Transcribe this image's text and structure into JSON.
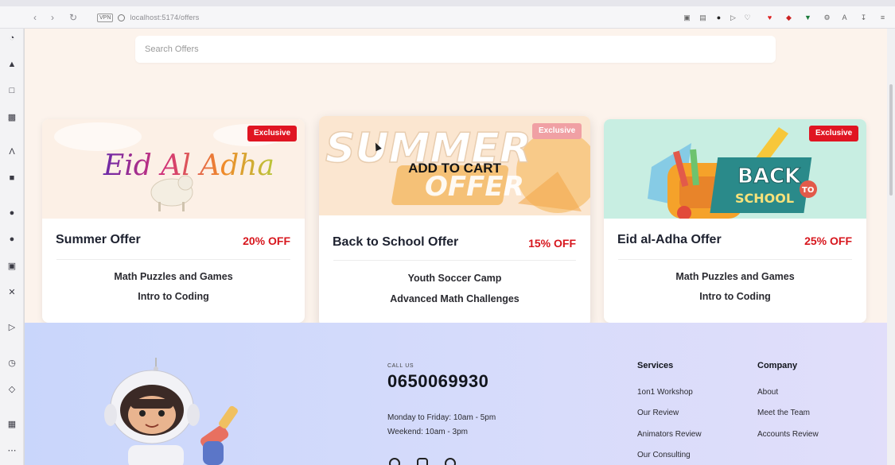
{
  "browser": {
    "url": "localhost:5174/offers",
    "vpn_label": "VPN"
  },
  "search": {
    "placeholder": "Search Offers"
  },
  "offers": [
    {
      "title": "Summer Offer",
      "discount": "20% OFF",
      "badge": "Exclusive",
      "image_alt": "Eid Al Adha",
      "courses": [
        "Math Puzzles and Games",
        "Intro to Coding"
      ]
    },
    {
      "title": "Back to School Offer",
      "discount": "15% OFF",
      "badge": "Exclusive",
      "image_alt": "Summer Offer",
      "image_line1": "SUMMER",
      "image_line2": "OFFER",
      "hover_label": "ADD TO CART",
      "courses": [
        "Youth Soccer Camp",
        "Advanced Math Challenges"
      ]
    },
    {
      "title": "Eid al-Adha Offer",
      "discount": "25% OFF",
      "badge": "Exclusive",
      "image_alt": "Back to School",
      "image_line1": "BACK",
      "image_line2": "SCHOOL",
      "image_to": "TO",
      "courses": [
        "Math Puzzles and Games",
        "Intro to Coding"
      ]
    }
  ],
  "footer": {
    "call_us_label": "CALL US",
    "phone": "0650069930",
    "hours": [
      "Monday to Friday: 10am - 5pm",
      "Weekend: 10am - 3pm"
    ],
    "services": {
      "title": "Services",
      "links": [
        "1on1 Workshop",
        "Our Review",
        "Animators Review",
        "Our Consulting"
      ]
    },
    "company": {
      "title": "Company",
      "links": [
        "About",
        "Meet the Team",
        "Accounts Review"
      ]
    }
  },
  "colors": {
    "accent": "#e01522",
    "page_bg": "#fcf3ec",
    "footer_bg_start": "#c9d6fb",
    "footer_bg_end": "#e1defa"
  }
}
